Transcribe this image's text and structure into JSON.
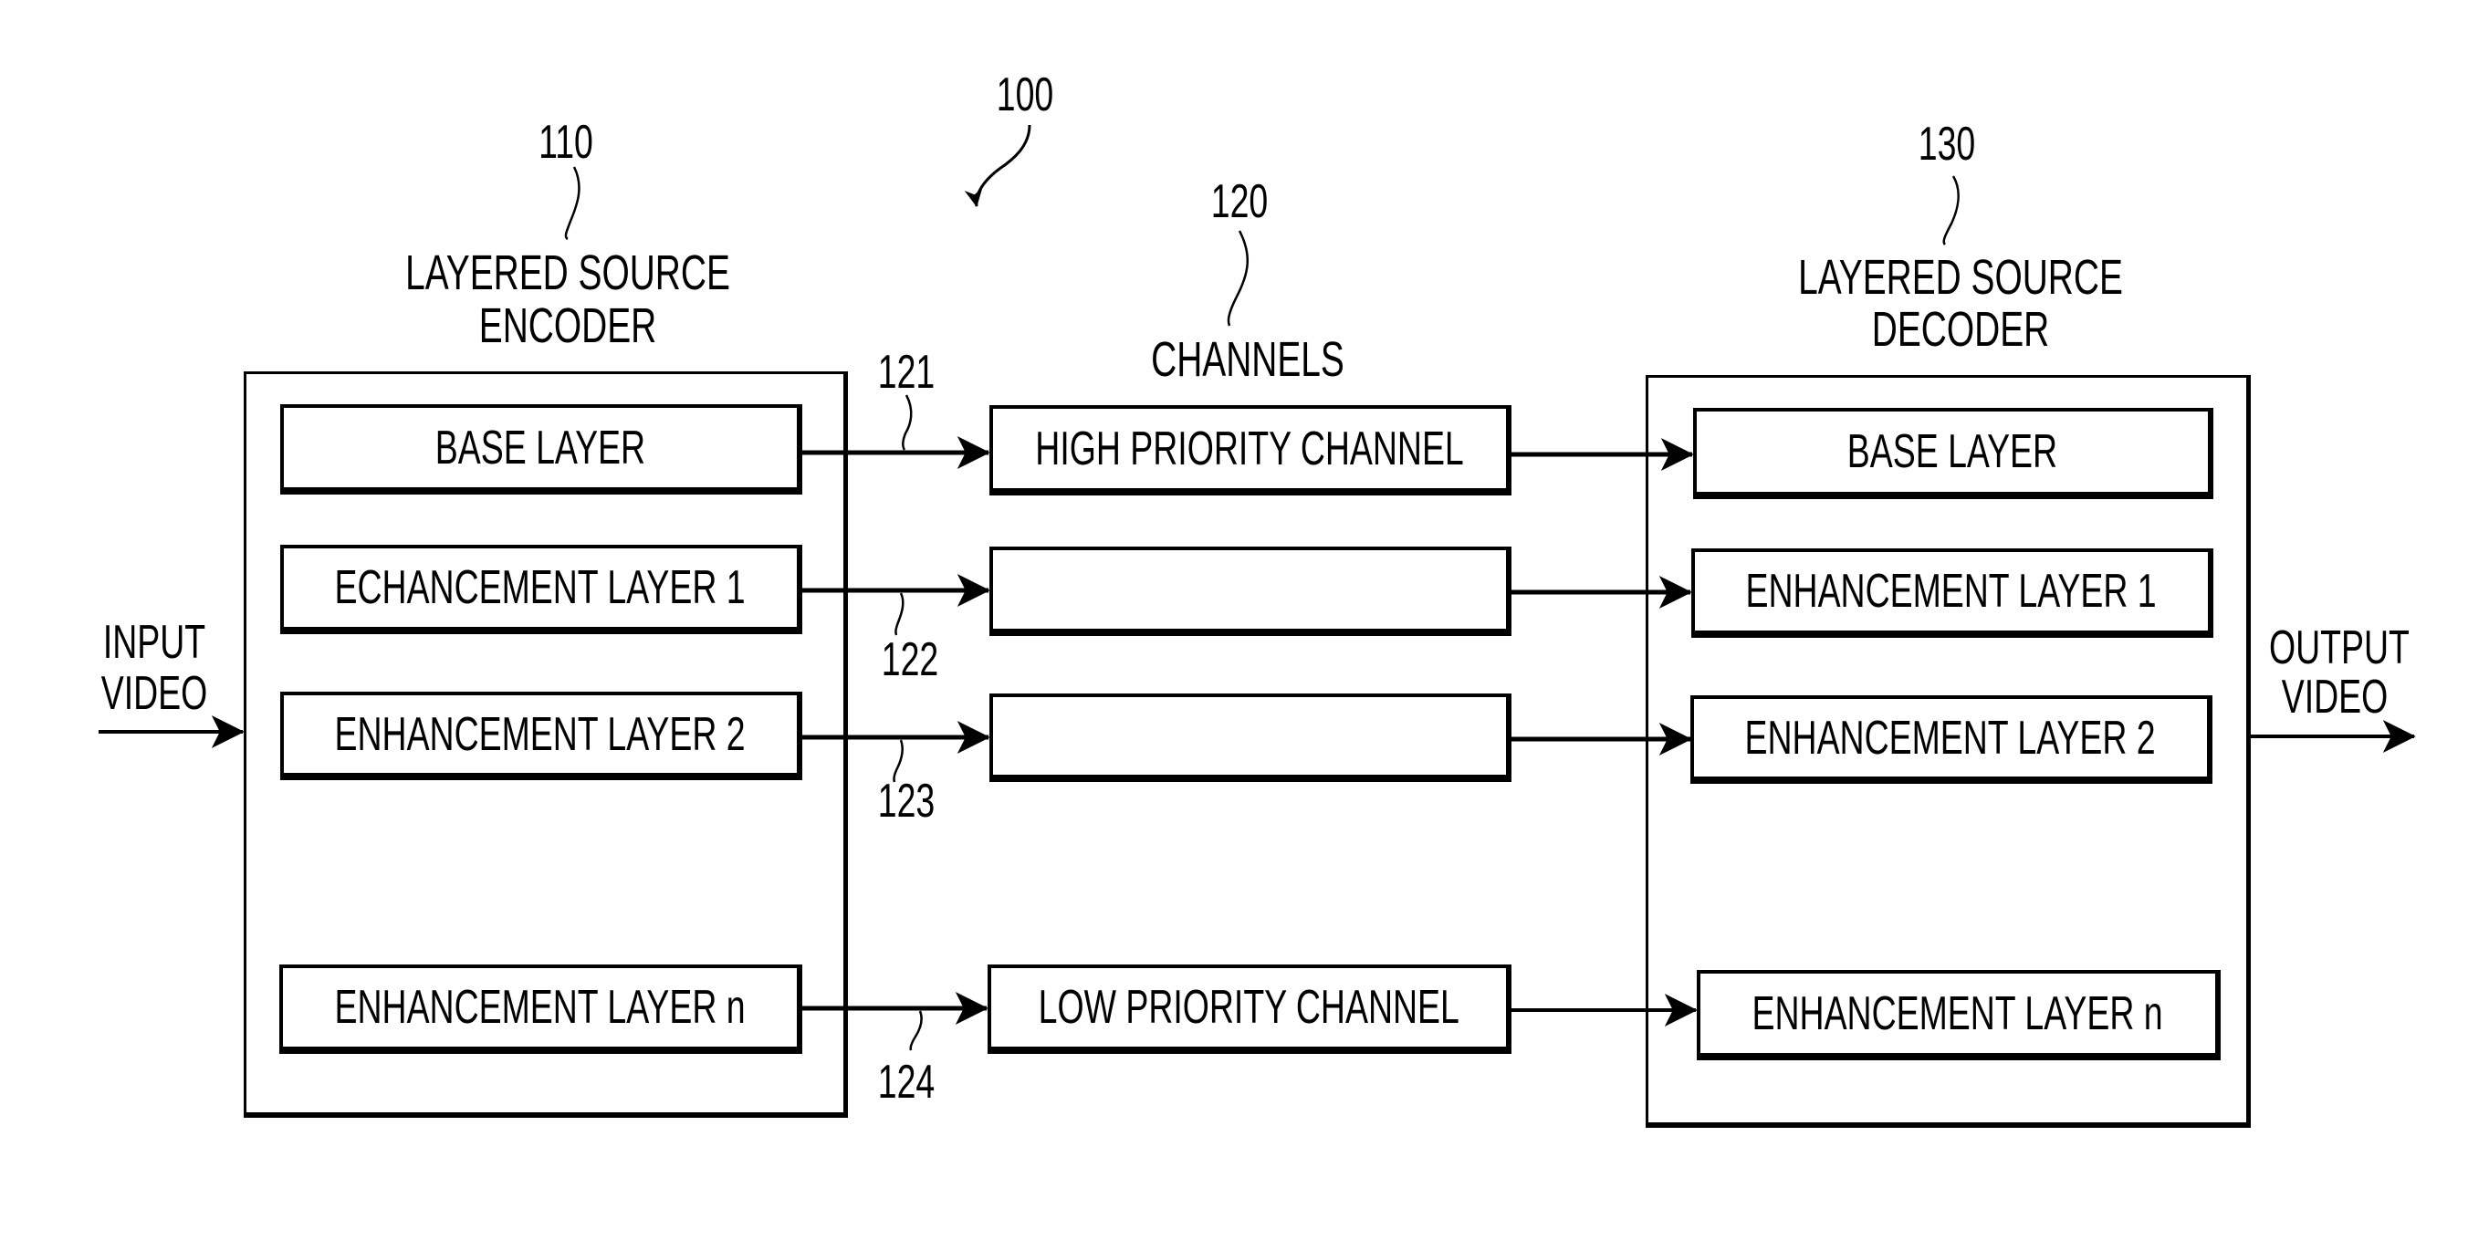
{
  "figure": {
    "system_ref": "100",
    "encoder": {
      "ref": "110",
      "title_line1": "LAYERED SOURCE",
      "title_line2": "ENCODER",
      "layers": [
        "BASE LAYER",
        "ECHANCEMENT LAYER 1",
        "ENHANCEMENT LAYER 2",
        "ENHANCEMENT LAYER n"
      ]
    },
    "channels": {
      "ref": "120",
      "title": "CHANNELS",
      "items": [
        "HIGH PRIORITY CHANNEL",
        "",
        "",
        "LOW PRIORITY CHANNEL"
      ],
      "link_refs": [
        "121",
        "122",
        "123",
        "124"
      ]
    },
    "decoder": {
      "ref": "130",
      "title_line1": "LAYERED SOURCE",
      "title_line2": "DECODER",
      "layers": [
        "BASE LAYER",
        "ENHANCEMENT LAYER 1",
        "ENHANCEMENT LAYER 2",
        "ENHANCEMENT LAYER n"
      ]
    },
    "input_label_line1": "INPUT",
    "input_label_line2": "VIDEO",
    "output_label_line1": "OUTPUT",
    "output_label_line2": "VIDEO"
  }
}
